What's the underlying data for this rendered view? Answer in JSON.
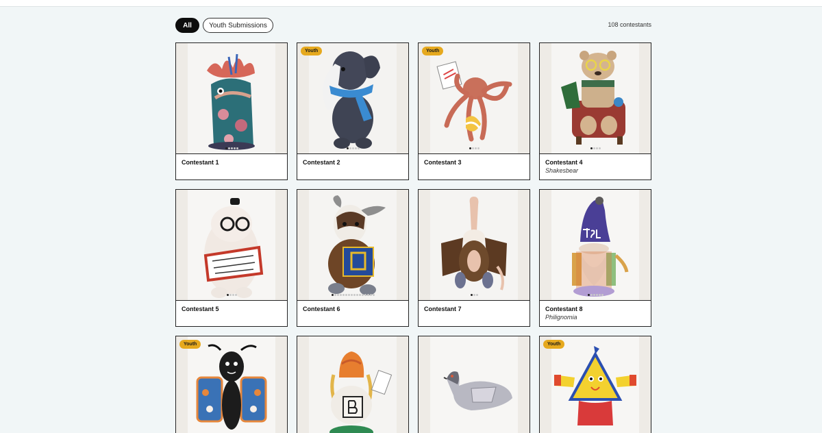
{
  "filters": {
    "all_label": "All",
    "youth_label": "Youth Submissions",
    "count_text": "108 contestants"
  },
  "cards": [
    {
      "title": "Contestant 1",
      "subtitle": "",
      "badge": "",
      "dots": 5,
      "active": 0,
      "figure": "textile-creature"
    },
    {
      "title": "Contestant 2",
      "subtitle": "",
      "badge": "Youth",
      "dots": 5,
      "active": 0,
      "figure": "bunny-with-blue-scarf"
    },
    {
      "title": "Contestant 3",
      "subtitle": "",
      "badge": "Youth",
      "dots": 4,
      "active": 0,
      "figure": "orange-octopus"
    },
    {
      "title": "Contestant 4",
      "subtitle": "Shakesbear",
      "badge": "",
      "dots": 4,
      "active": 0,
      "figure": "bear-in-armchair"
    },
    {
      "title": "Contestant 5",
      "subtitle": "",
      "badge": "",
      "dots": 4,
      "active": 0,
      "figure": "white-creature-with-book"
    },
    {
      "title": "Contestant 6",
      "subtitle": "",
      "badge": "",
      "dots": 16,
      "active": 0,
      "figure": "moose-with-book"
    },
    {
      "title": "Contestant 7",
      "subtitle": "",
      "badge": "",
      "dots": 3,
      "active": 0,
      "figure": "vulture"
    },
    {
      "title": "Contestant 8",
      "subtitle": "Philignomia",
      "badge": "",
      "dots": 6,
      "active": 0,
      "figure": "gnome-bpl"
    },
    {
      "title": "",
      "subtitle": "",
      "badge": "Youth",
      "dots": 0,
      "active": 0,
      "figure": "butterfly"
    },
    {
      "title": "",
      "subtitle": "",
      "badge": "",
      "dots": 0,
      "active": 0,
      "figure": "gnome-with-block"
    },
    {
      "title": "",
      "subtitle": "",
      "badge": "",
      "dots": 0,
      "active": 0,
      "figure": "pigeon"
    },
    {
      "title": "",
      "subtitle": "",
      "badge": "Youth",
      "dots": 0,
      "active": 0,
      "figure": "yellow-triangle-creature"
    }
  ],
  "colors": {
    "page_bg": "#f1f6f7",
    "badge": "#e6a91e",
    "pill_active": "#0d0d0d"
  }
}
